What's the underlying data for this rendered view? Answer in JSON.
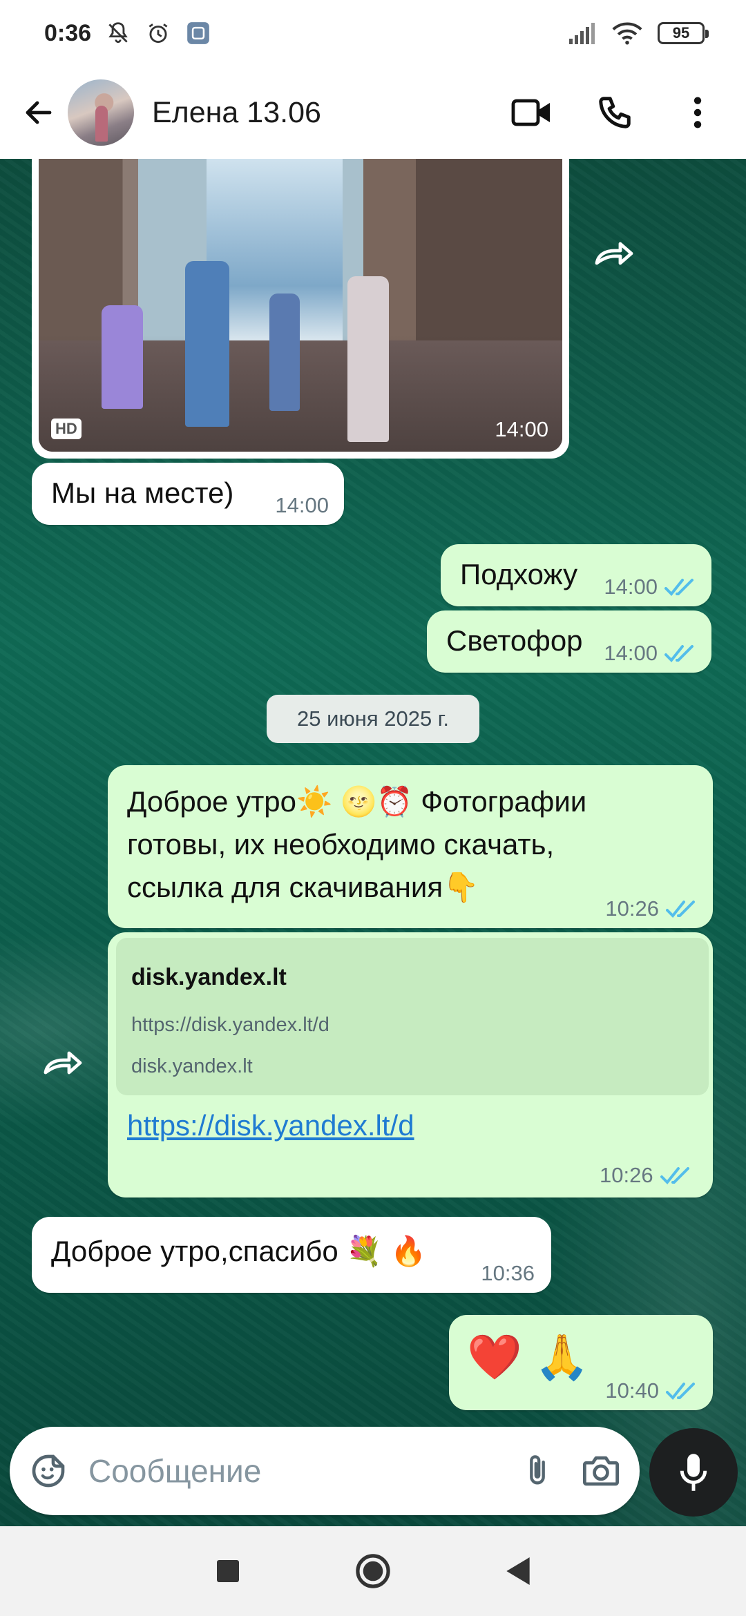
{
  "status_bar": {
    "time": "0:36",
    "battery": "95"
  },
  "header": {
    "contact_name": "Елена 13.06"
  },
  "messages": [
    {
      "id": "photo",
      "direction": "in",
      "type": "image",
      "badge": "HD",
      "time": "14:00"
    },
    {
      "id": "m1",
      "direction": "in",
      "text": "Мы на месте)",
      "time": "14:00"
    },
    {
      "id": "m2",
      "direction": "out",
      "text": "Подхожу",
      "time": "14:00",
      "status": "read"
    },
    {
      "id": "m3",
      "direction": "out",
      "text": "Светофор",
      "time": "14:00",
      "status": "read"
    },
    {
      "id": "m4",
      "direction": "out",
      "lines": [
        "Доброе утро☀️ 🌝⏰  Фотографии",
        "готовы, их необходимо скачать,",
        "ссылка для скачивания👇"
      ],
      "time": "10:26",
      "status": "read"
    },
    {
      "id": "m5",
      "direction": "out",
      "type": "link",
      "link_title": "disk.yandex.lt",
      "link_url": "https://disk.yandex.lt/d",
      "link_domain": "disk.yandex.lt",
      "text": "https://disk.yandex.lt/d",
      "time": "10:26",
      "status": "read"
    },
    {
      "id": "m6",
      "direction": "in",
      "text": "Доброе утро,спасибо 💐 🔥",
      "time": "10:36"
    },
    {
      "id": "m7",
      "direction": "out",
      "text": "❤️ 🙏",
      "time": "10:40",
      "status": "read"
    }
  ],
  "date_separator": "25 июня 2025 г.",
  "composer": {
    "placeholder": "Сообщение"
  },
  "colors": {
    "outgoing_bubble": "#d9fdd3",
    "incoming_bubble": "#ffffff",
    "read_ticks": "#53bdeb",
    "link": "#1f7bd2"
  }
}
